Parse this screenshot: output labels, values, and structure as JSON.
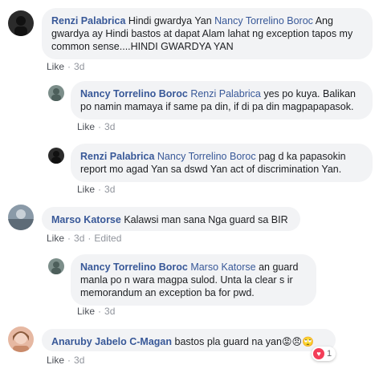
{
  "comments": [
    {
      "author": "Renzi Palabrica",
      "text_pre": "Hindi gwardya Yan",
      "mention": "Nancy Torrelino Boroc",
      "text_post": "Ang gwardya ay Hindi bastos at dapat Alam lahat ng exception tapos my common sense....HINDI GWARDYA YAN",
      "like": "Like",
      "time": "3d"
    },
    {
      "author": "Nancy Torrelino Boroc",
      "mention": "Renzi Palabrica",
      "text_post": "yes po kuya. Balikan po namin mamaya if same pa din, if di pa din magpapapasok.",
      "like": "Like",
      "time": "3d"
    },
    {
      "author": "Renzi Palabrica",
      "mention": "Nancy Torrelino Boroc",
      "text_post": "pag d ka papasokin report mo agad Yan sa dswd Yan act of discrimination Yan.",
      "like": "Like",
      "time": "3d"
    },
    {
      "author": "Marso Katorse",
      "text_post": "Kalawsi man sana Nga guard sa BIR",
      "like": "Like",
      "time": "3d",
      "edited": "Edited"
    },
    {
      "author": "Nancy Torrelino Boroc",
      "mention": "Marso Katorse",
      "text_post": "an guard manla po n wara magpa sulod. Unta la clear s ir memorandum an exception ba for pwd.",
      "like": "Like",
      "time": "3d"
    },
    {
      "author": "Anaruby Jabelo C-Magan",
      "text_post": "bastos pla guard na yan",
      "emojis": "😡😠🙄",
      "like": "Like",
      "time": "3d",
      "reaction_count": "1"
    }
  ],
  "separator": "·",
  "colors": {
    "link": "#385898",
    "bubble": "#f2f3f5",
    "meta": "#90949c",
    "heart": "#f33e58"
  }
}
